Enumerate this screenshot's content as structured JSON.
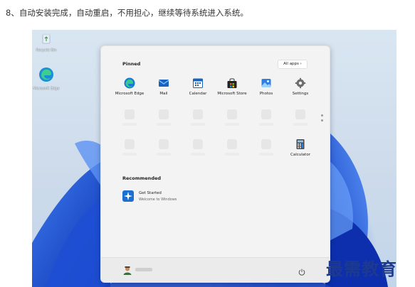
{
  "caption": "8、自动安装完成，自动重启，不用担心，继续等待系统进入系统。",
  "desktop": {
    "icons": [
      {
        "label": "Recycle Bin",
        "icon": "recycle-bin-icon"
      },
      {
        "label": "Microsoft Edge",
        "icon": "edge-icon"
      }
    ]
  },
  "start_menu": {
    "pinned_title": "Pinned",
    "all_apps_label": "All apps",
    "pinned_apps": [
      {
        "label": "Microsoft Edge",
        "icon": "edge-icon"
      },
      {
        "label": "Mail",
        "icon": "mail-icon"
      },
      {
        "label": "Calendar",
        "icon": "calendar-icon"
      },
      {
        "label": "Microsoft Store",
        "icon": "store-icon"
      },
      {
        "label": "Photos",
        "icon": "photos-icon"
      },
      {
        "label": "Settings",
        "icon": "gear-icon"
      },
      {
        "label": "Calculator",
        "icon": "calculator-icon"
      }
    ],
    "recommended_title": "Recommended",
    "recommended": [
      {
        "title": "Get Started",
        "subtitle": "Welcome to Windows",
        "icon": "get-started-icon"
      }
    ]
  },
  "watermark": "最需教育",
  "colors": {
    "accent": "#0067c0",
    "wallpaper_bloom": "#1a56d6",
    "watermark": "#1d3a8f"
  }
}
